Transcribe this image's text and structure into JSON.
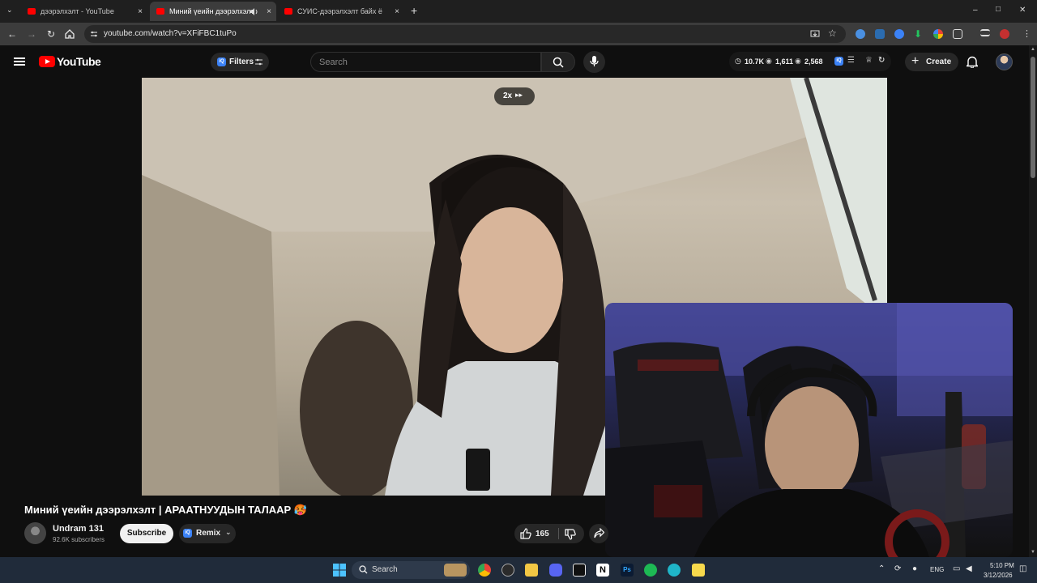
{
  "browser": {
    "tabs": [
      {
        "label": "дээрэлхэлт - YouTube",
        "active": false
      },
      {
        "label": "Миний үеийн дээрэлхэлт | ",
        "active": true
      },
      {
        "label": "СУИС-дээрэлхэлт байх ёстой ",
        "active": false
      }
    ],
    "new_tab": "+",
    "close": "×",
    "url": "youtube.com/watch?v=XFiFBC1tuPo",
    "win_minimize": "–",
    "win_maximize": "□",
    "win_close": "✕"
  },
  "youtube": {
    "logo_text": "YouTube",
    "filters_label": "Filters",
    "iq_badge": "iQ",
    "search_placeholder": "Search",
    "stats": {
      "views": "10.7K",
      "likes": "1,611",
      "other": "2,568"
    },
    "create_label": "Create",
    "speed_label": "2x"
  },
  "video": {
    "title": "Миний үеийн дээрэлхэлт | АРААТНУУДЫН ТАЛААР 🥵",
    "channel_name": "Undram 131",
    "subscribers": "92.6K subscribers",
    "subscribe_label": "Subscribe",
    "remix_label": "Remix",
    "like_count": "165"
  },
  "taskbar": {
    "search_label": "Search",
    "language": "ENG",
    "time": "5:10 PM",
    "date": "3/12/2026"
  },
  "colors": {
    "brand_red": "#ff0000",
    "accent_blue": "#3b82f6",
    "bg": "#0f0f0f"
  }
}
